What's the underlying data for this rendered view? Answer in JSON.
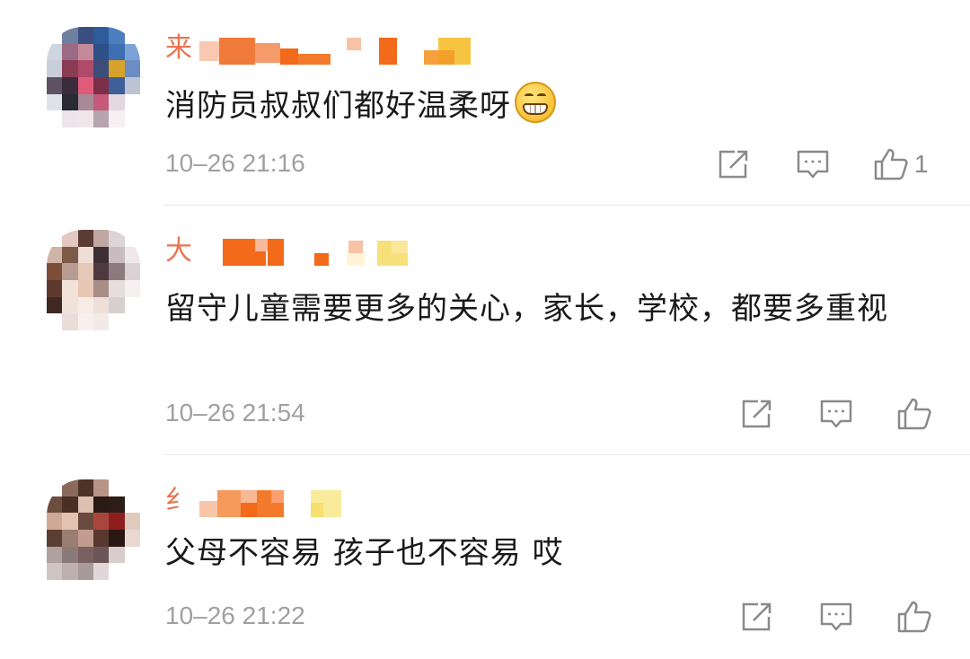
{
  "comments": [
    {
      "username_first_char": "来",
      "text": "消防员叔叔们都好温柔呀",
      "emoji": "grin-emoji",
      "time": "10–26 21:16",
      "like_count": "1"
    },
    {
      "username_first_char": "大",
      "text": "留守儿童需要更多的关心，家长，学校，都要多重视",
      "time": "10–26 21:54",
      "like_count": ""
    },
    {
      "username_first_char": "纟",
      "text": "父母不容易 孩子也不容易 哎",
      "time": "10–26 21:22",
      "like_count": ""
    }
  ],
  "icons": {
    "repost": "share-icon",
    "reply": "comment-icon",
    "like": "thumbs-up-icon"
  },
  "colors": {
    "username": "#eb7350",
    "text": "#1a1a1a",
    "timestamp": "#a0a0a0",
    "icon": "#8a8a8a",
    "divider": "#e8e8e8"
  }
}
